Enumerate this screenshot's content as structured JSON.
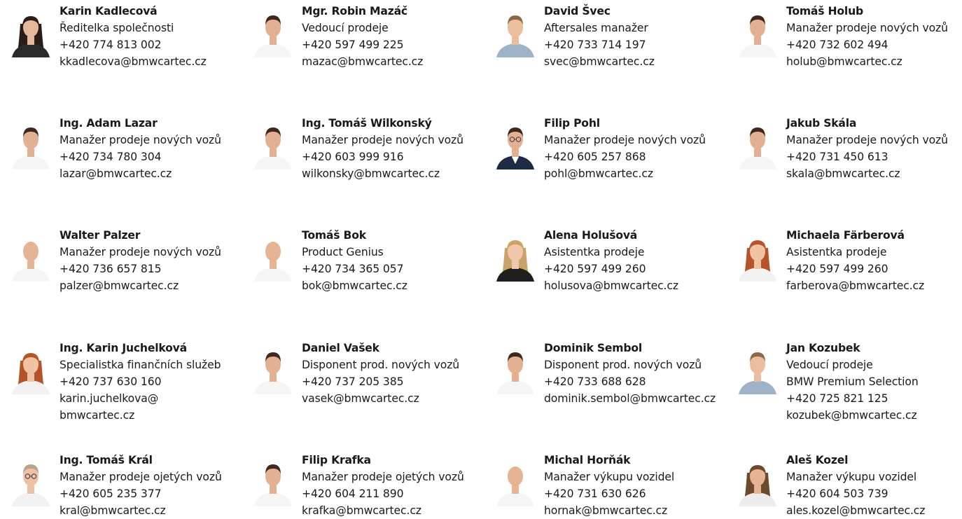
{
  "contacts": [
    {
      "name": "Karin Kadlecová",
      "role": "Ředitelka společnosti",
      "phone": "+420 774 813 002",
      "email": "kkadlecova@bmwcartec.cz",
      "photo_icon": "portrait-photo"
    },
    {
      "name": "Mgr. Robin Mazáč",
      "role": "Vedoucí prodeje",
      "phone": "+420 597 499 225",
      "email": "mazac@bmwcartec.cz",
      "photo_icon": "portrait-photo"
    },
    {
      "name": "David Švec",
      "role": "Aftersales manažer",
      "phone": "+420 733 714 197",
      "email": "svec@bmwcartec.cz",
      "photo_icon": "portrait-photo"
    },
    {
      "name": "Tomáš Holub",
      "role": "Manažer prodeje nových vozů",
      "phone": "+420 732 602 494",
      "email": "holub@bmwcartec.cz",
      "photo_icon": "portrait-photo"
    },
    {
      "name": "Ing. Adam Lazar",
      "role": "Manažer prodeje nových vozů",
      "phone": "+420 734 780 304",
      "email": "lazar@bmwcartec.cz",
      "photo_icon": "portrait-photo"
    },
    {
      "name": "Ing. Tomáš Wilkonský",
      "role": "Manažer prodeje nových vozů",
      "phone": "+420 603 999 916",
      "email": "wilkonsky@bmwcartec.cz",
      "photo_icon": "portrait-photo"
    },
    {
      "name": "Filip Pohl",
      "role": "Manažer prodeje nových vozů",
      "phone": "+420 605 257 868",
      "email": "pohl@bmwcartec.cz",
      "photo_icon": "portrait-photo"
    },
    {
      "name": "Jakub Skála",
      "role": "Manažer prodeje nových vozů",
      "phone": "+420 731 450 613",
      "email": "skala@bmwcartec.cz",
      "photo_icon": "portrait-photo"
    },
    {
      "name": "Walter Palzer",
      "role": "Manažer prodeje nových vozů",
      "phone": "+420 736 657 815",
      "email": "palzer@bmwcartec.cz",
      "photo_icon": "portrait-photo"
    },
    {
      "name": "Tomáš Bok",
      "role": "Product Genius",
      "phone": "+420 734 365 057",
      "email": "bok@bmwcartec.cz",
      "photo_icon": "portrait-photo"
    },
    {
      "name": "Alena Holušová",
      "role": "Asistentka prodeje",
      "phone": "+420 597 499 260",
      "email": "holusova@bmwcartec.cz",
      "photo_icon": "portrait-photo"
    },
    {
      "name": "Michaela Färberová",
      "role": "Asistentka prodeje",
      "phone": "+420 597 499 260",
      "email": "farberova@bmwcartec.cz",
      "photo_icon": "portrait-photo"
    },
    {
      "name": "Ing. Karin Juchelková",
      "role": "Specialistka finančních služeb",
      "phone": "+420 737 630 160",
      "email": "karin.juchelkova@\nbmwcartec.cz",
      "photo_icon": "portrait-photo"
    },
    {
      "name": "Daniel Vašek",
      "role": "Disponent prod. nových vozů",
      "phone": "+420 737 205 385",
      "email": "vasek@bmwcartec.cz",
      "photo_icon": "portrait-photo"
    },
    {
      "name": "Dominik Sembol",
      "role": "Disponent prod. nových vozů",
      "phone": "+420 733 688 628",
      "email": "dominik.sembol@bmwcartec.cz",
      "photo_icon": "portrait-photo"
    },
    {
      "name": "Jan Kozubek",
      "role": "Vedoucí prodeje",
      "role2": "BMW Premium Selection",
      "phone": "+420 725 821 125",
      "email": "kozubek@bmwcartec.cz",
      "photo_icon": "portrait-photo"
    },
    {
      "name": "Ing. Tomáš Král",
      "role": "Manažer prodeje ojetých vozů",
      "phone": "+420 605 235 377",
      "email": "kral@bmwcartec.cz",
      "photo_icon": "portrait-photo"
    },
    {
      "name": "Filip Krafka",
      "role": "Manažer prodeje ojetých vozů",
      "phone": "+420 604 211 890",
      "email": "krafka@bmwcartec.cz",
      "photo_icon": "portrait-photo"
    },
    {
      "name": "Michal Horňák",
      "role": "Manažer výkupu vozidel",
      "phone": "+420 731 630 626",
      "email": "hornak@bmwcartec.cz",
      "photo_icon": "portrait-photo"
    },
    {
      "name": "Aleš Kozel",
      "role": "Manažer výkupu vozidel",
      "phone": "+420 604 503 739",
      "email": "ales.kozel@bmwcartec.cz",
      "photo_icon": "portrait-photo"
    }
  ],
  "colors": {
    "background": "#ffffff",
    "text": "#1a1a1a",
    "skin": "#e8bfa6",
    "photo_bg": "#f4f4f4"
  }
}
